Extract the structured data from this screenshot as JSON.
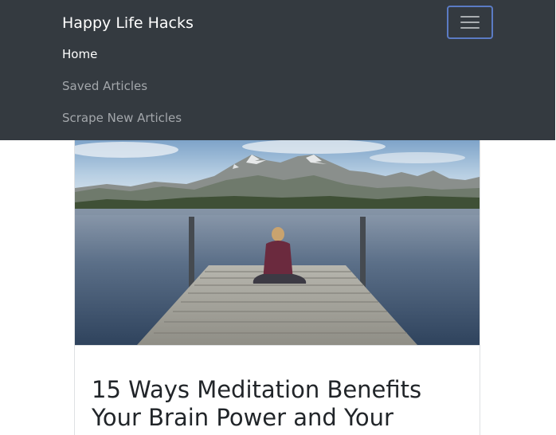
{
  "navbar": {
    "brand": "Happy Life Hacks",
    "toggler_icon": "hamburger-menu-icon",
    "links": [
      {
        "label": "Home",
        "active": true
      },
      {
        "label": "Saved Articles",
        "active": false
      },
      {
        "label": "Scrape New Articles",
        "active": false
      }
    ]
  },
  "article": {
    "image_subject": "person sitting on wooden dock facing lake and mountains",
    "title": "15 Ways Meditation Benefits Your Brain Power and Your"
  },
  "colors": {
    "navbar_bg": "#343a40",
    "toggler_border": "#5b7bc4",
    "link_active": "#ffffff",
    "link_inactive": "#a3a7ab"
  }
}
